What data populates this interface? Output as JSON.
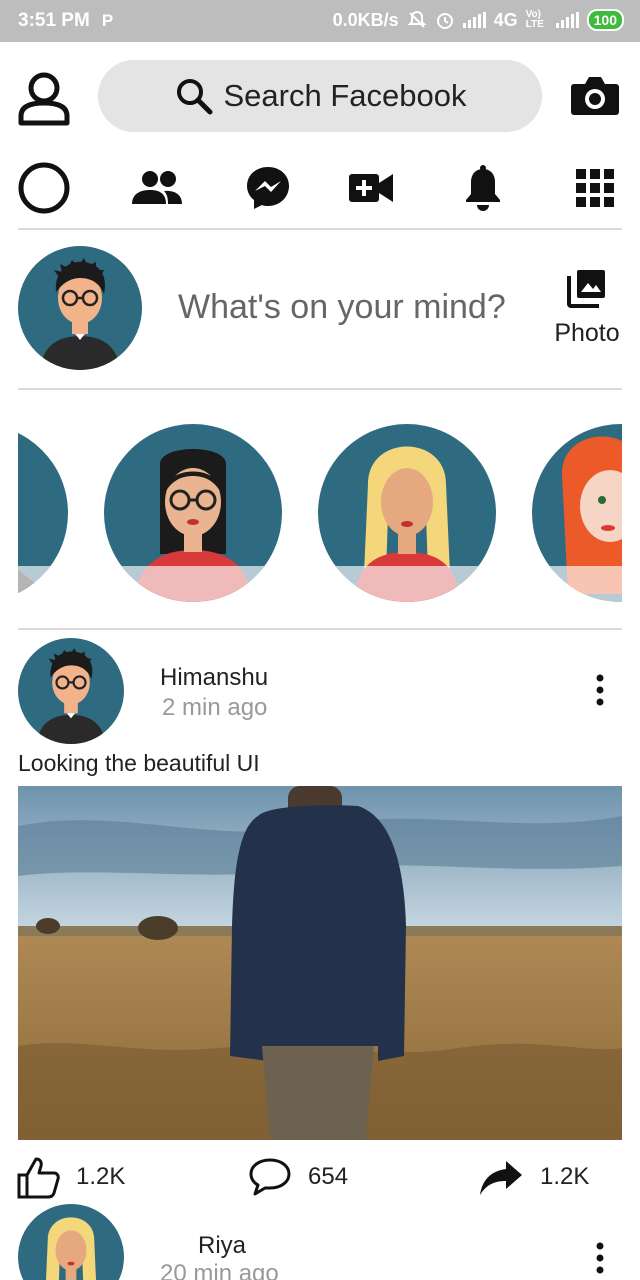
{
  "status_bar": {
    "time": "3:51 PM",
    "notif_glyph": "P",
    "net_speed": "0.0KB/s",
    "net_type": "4G",
    "volte": "Vo) LTE",
    "battery": "100"
  },
  "header": {
    "search_placeholder": "Search Facebook",
    "icons": [
      "profile-icon",
      "search-icon",
      "camera-icon"
    ]
  },
  "nav": {
    "icons": [
      "home-circle-icon",
      "friends-icon",
      "messenger-icon",
      "video-icon",
      "bell-icon",
      "menu-grid-icon"
    ]
  },
  "composer": {
    "prompt": "What's on your mind?",
    "photo_label": "Photo"
  },
  "posts": [
    {
      "author": "Himanshu",
      "time": "2 min ago",
      "text": "Looking the beautiful UI",
      "likes": "1.2K",
      "comments": "654",
      "shares": "1.2K"
    },
    {
      "author": "Riya",
      "time": "20 min ago"
    }
  ],
  "colors": {
    "avatar_bg": "#2f6b80",
    "search_bg": "#e4e4e4",
    "status_bar_bg": "#bdbdbd"
  }
}
